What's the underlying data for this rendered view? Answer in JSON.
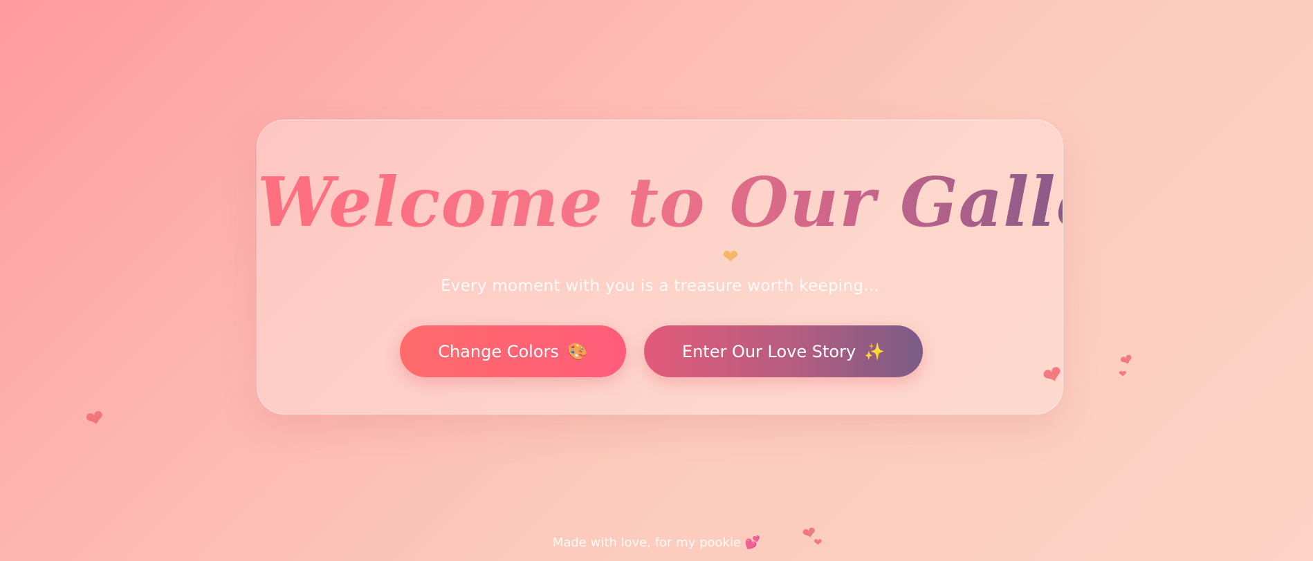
{
  "hero": {
    "title": "Welcome to Our Gallery",
    "title_heart": "❤",
    "subtitle": "Every moment with you is a treasure worth keeping..."
  },
  "buttons": {
    "change_colors": {
      "label": "Change Colors",
      "emoji": "🎨"
    },
    "enter_story": {
      "label": "Enter Our Love Story",
      "emoji": "✨"
    }
  },
  "decor": {
    "heart_glyph": "❤",
    "heart_color": "#f27078"
  },
  "footer": {
    "text": "Made with love, for my pookie",
    "emoji": "💕"
  },
  "colors": {
    "background_start": "#ff9a9e",
    "background_end": "#fcd3c4",
    "primary_button": "#ff6b6b",
    "secondary_button_end": "#7a5c86"
  }
}
